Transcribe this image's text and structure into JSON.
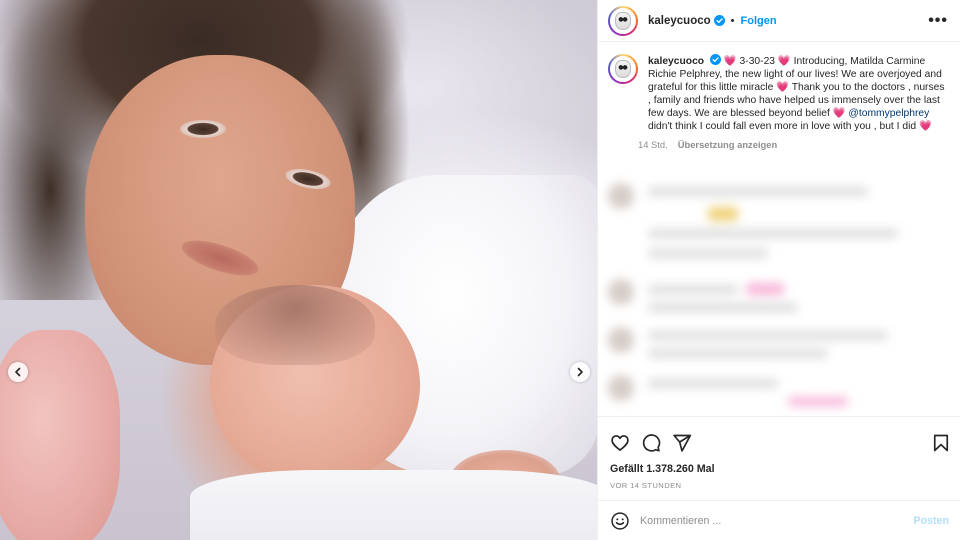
{
  "photo": {
    "nav_prev_icon": "chevron-left-icon",
    "nav_next_icon": "chevron-right-icon"
  },
  "header": {
    "username": "kaleycuoco",
    "verified_icon": "verified-badge-icon",
    "separator": "•",
    "follow_label": "Folgen",
    "more_label": "•••"
  },
  "caption": {
    "username": "kaleycuoco",
    "text_1": " 3-30-23 ",
    "text_2": " Introducing, Matilda Carmine Richie Pelphrey, the new light of our lives! We are overjoyed and grateful for this little miracle ",
    "text_3": " Thank you to the doctors , nurses , family and friends who have helped us immensely over the last few days. We are blessed beyond belief ",
    "mention": "@tommypelphrey",
    "text_4": " didn't think I could fall even more in love with you , but I did ",
    "heart": "💗",
    "time": "14 Std.",
    "translate_label": "Übersetzung anzeigen"
  },
  "actions": {
    "like_icon": "heart-outline-icon",
    "comment_icon": "comment-bubble-icon",
    "share_icon": "paper-plane-icon",
    "save_icon": "bookmark-icon",
    "likes_text": "Gefällt 1.378.260 Mal",
    "posted_ago": "VOR 14 STUNDEN"
  },
  "comment_box": {
    "emoji_icon": "smiley-icon",
    "placeholder": "Kommentieren ...",
    "post_label": "Posten"
  },
  "colors": {
    "link_blue": "#0095f6",
    "post_disabled_blue": "#b2dffc",
    "heart_pink": "#ff4da6",
    "mention_navy": "#00376b"
  }
}
